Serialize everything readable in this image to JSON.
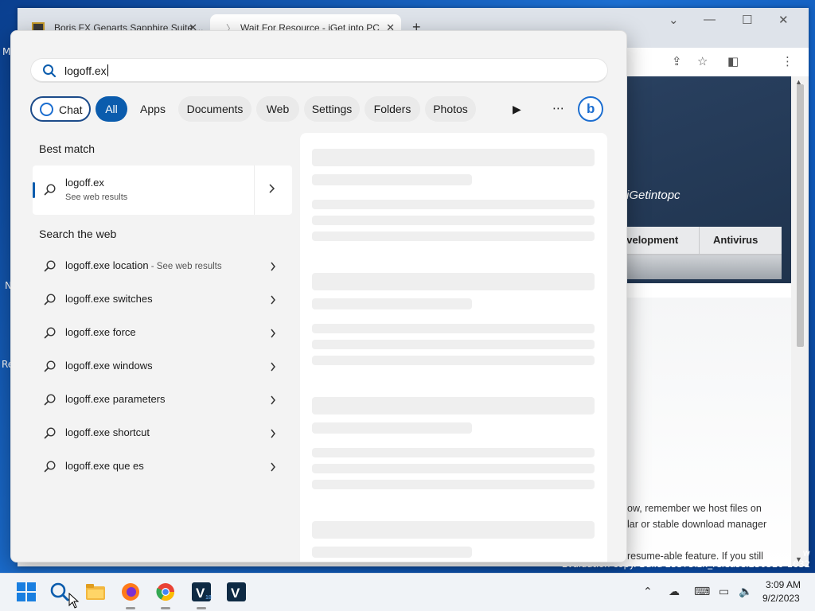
{
  "browser": {
    "tabs": [
      {
        "title": "Boris FX Genarts Sapphire Suite ..."
      },
      {
        "title": "Wait For Resource - iGet into PC"
      }
    ],
    "hero_text": "iGetintopc",
    "menu": [
      "evelopment",
      "Antivirus"
    ],
    "content_lines": [
      "ow, remember we host files on",
      "lar or stable download manager",
      "resume-able feature. If you still"
    ]
  },
  "desktop": {
    "left_fragments": [
      "M",
      "N",
      "Re"
    ],
    "watermark_line1": "w",
    "watermark_line2": "Evaluation copy. Build 25375.zn_release.230520-1632"
  },
  "search": {
    "query": "logoff.ex",
    "filters": [
      "Chat",
      "All",
      "Apps",
      "Documents",
      "Web",
      "Settings",
      "Folders",
      "Photos"
    ],
    "best_match_title": "Best match",
    "best_match": {
      "name": "logoff.ex",
      "subtitle": "See web results"
    },
    "web_title": "Search the web",
    "web_results": [
      {
        "text": "logoff.exe location",
        "hint": " - See web results"
      },
      {
        "text": "logoff.exe switches",
        "hint": ""
      },
      {
        "text": "logoff.exe force",
        "hint": ""
      },
      {
        "text": "logoff.exe windows",
        "hint": ""
      },
      {
        "text": "logoff.exe parameters",
        "hint": ""
      },
      {
        "text": "logoff.exe shortcut",
        "hint": ""
      },
      {
        "text": "logoff.exe que es",
        "hint": ""
      }
    ]
  },
  "taskbar": {
    "apps": [
      "start-icon",
      "search-icon",
      "file-explorer-icon",
      "firefox-icon",
      "chrome-icon",
      "vmware-icon",
      "v-app-icon"
    ],
    "time": "3:09 AM",
    "date": "9/2/2023"
  }
}
